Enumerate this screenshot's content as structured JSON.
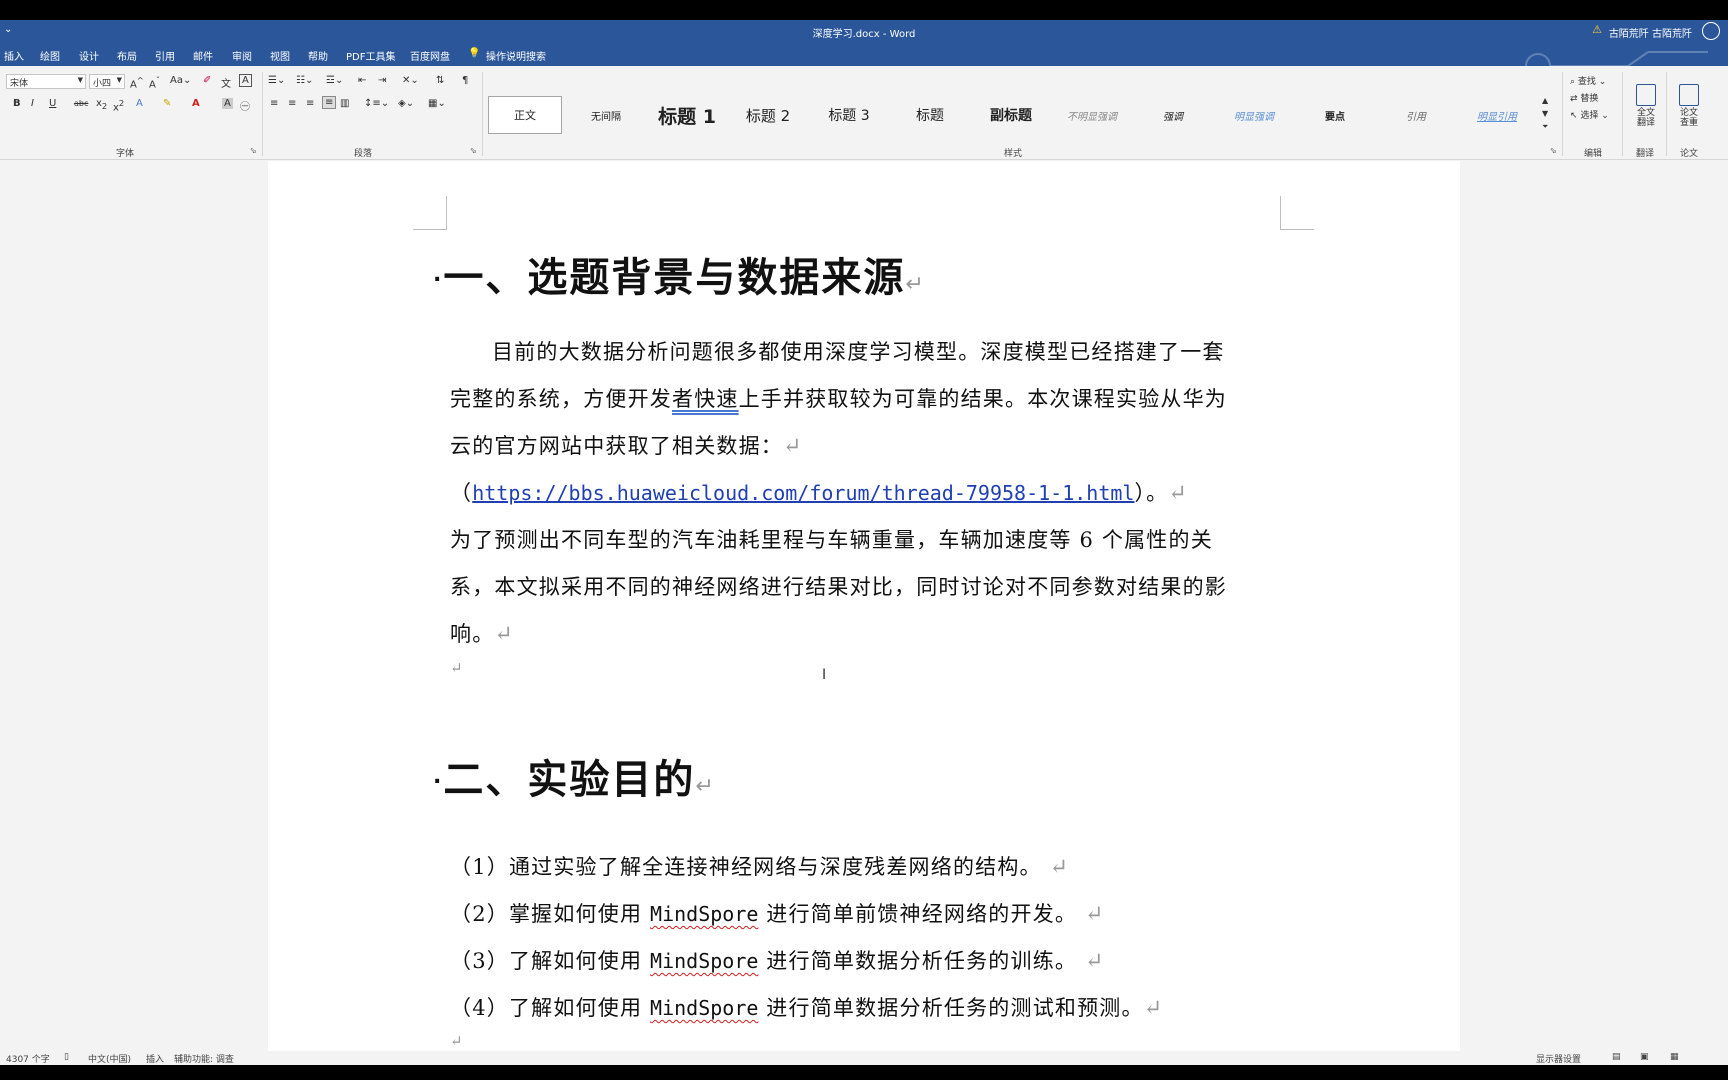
{
  "titlebar": {
    "quick_access": "⌄",
    "title": "深度学习.docx  -  Word",
    "user": "古陌荒阡 古陌荒阡"
  },
  "tabs": [
    "插入",
    "绘图",
    "设计",
    "布局",
    "引用",
    "邮件",
    "审阅",
    "视图",
    "帮助",
    "PDF工具集",
    "百度网盘"
  ],
  "search_label": "操作说明搜索",
  "ribbon": {
    "font_name": "宋体",
    "font_size": "小四",
    "font_group": "字体",
    "paragraph_group": "段落",
    "styles_group": "样式",
    "styles": [
      "正文",
      "无间隔",
      "标题 1",
      "标题 2",
      "标题 3",
      "标题",
      "副标题",
      "不明显强调",
      "强调",
      "明显强调",
      "要点",
      "引用",
      "明显引用"
    ],
    "edit": {
      "find": "查找",
      "replace": "替换",
      "select": "选择",
      "group": "编辑"
    },
    "translate": {
      "label": "全文\n翻译",
      "group": "翻译"
    },
    "paper": {
      "label": "论文\n查重",
      "group": "论文"
    }
  },
  "document": {
    "heading1": "一、选题背景与数据来源",
    "p1_line1": "目前的大数据分析问题很多都使用深度学习模型。深度模型已经搭建了一套",
    "p1_line2a": "完整的系统，方便开发",
    "p1_line2b": "者快速",
    "p1_line2c": "上手并获取较为可靠的结果。本次课程实验从华为",
    "p1_line3": "云的官方网站中获取了相关数据：",
    "link_open": "（",
    "link": "https://bbs.huaweicloud.com/forum/thread-79958-1-1.html",
    "link_close": "）。",
    "p2_line1": "为了预测出不同车型的汽车油耗里程与车辆重量，车辆加速度等 6 个属性的关",
    "p2_line2": "系，本文拟采用不同的神经网络进行结果对比，同时讨论对不同参数对结果的影",
    "p2_line3": "响。",
    "heading2": "二、实验目的",
    "goals": [
      {
        "prefix": "（1）通过实验了解全连接神经网络与深度残差网络的结构。",
        "mid": "",
        "suffix": ""
      },
      {
        "prefix": "（2）掌握如何使用 ",
        "mid": "MindSpore",
        "suffix": " 进行简单前馈神经网络的开发。"
      },
      {
        "prefix": "（3）了解如何使用 ",
        "mid": "MindSpore",
        "suffix": " 进行简单数据分析任务的训练。"
      },
      {
        "prefix": "（4）了解如何使用 ",
        "mid": "MindSpore",
        "suffix": " 进行简单数据分析任务的测试和预测。"
      }
    ],
    "para_mark": "↵"
  },
  "statusbar": {
    "words": "4307 个字",
    "language": "中文(中国)",
    "insert": "插入",
    "accessibility": "辅助功能: 调查",
    "display": "显示器设置"
  }
}
